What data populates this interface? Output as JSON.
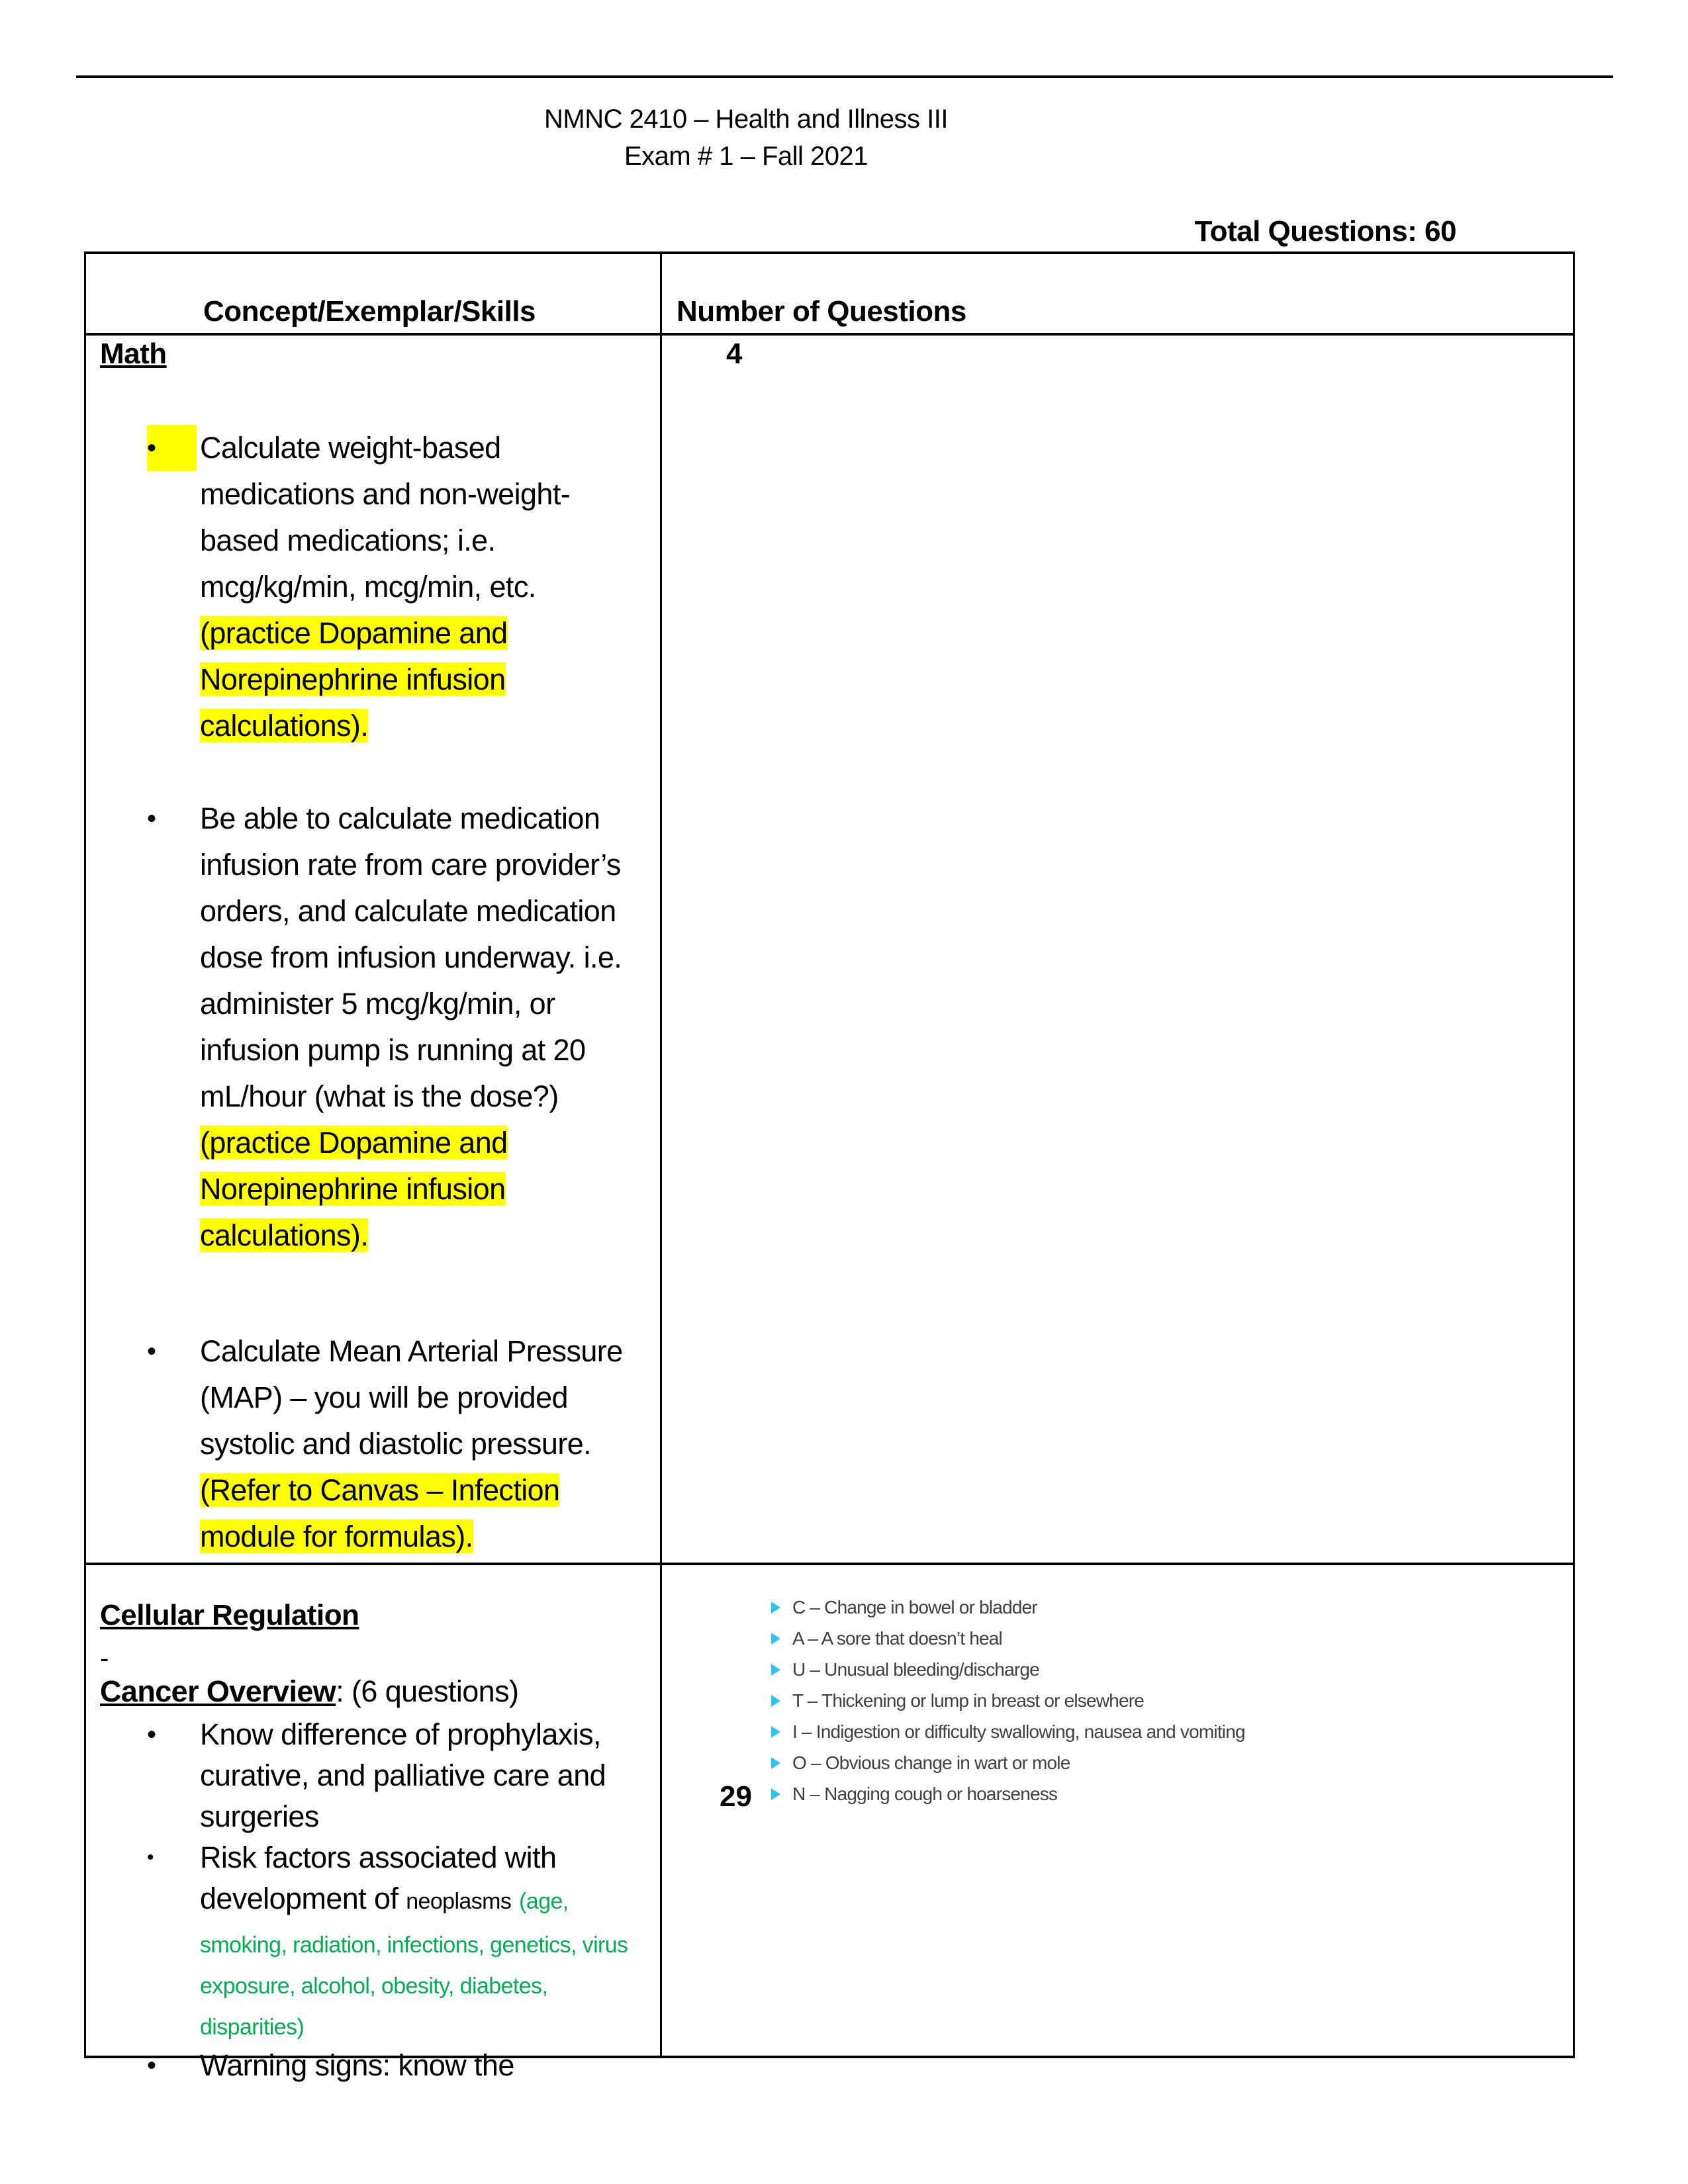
{
  "document": {
    "title_line1": "NMNC 2410 – Health and Illness III",
    "title_line2": "Exam # 1 – Fall 2021",
    "total_questions": "Total Questions: 60"
  },
  "table": {
    "headers": [
      "Concept/Exemplar/Skills",
      "Number of Questions"
    ],
    "rows": [
      {
        "section": "Math",
        "count": "4",
        "bullets": [
          {
            "text": "Calculate weight-based medications and non-weight-based medications; i.e. mcg/kg/min, mcg/min, etc.",
            "highlight": "(practice Dopamine and Norepinephrine infusion calculations)."
          },
          {
            "text": "Be able to calculate medication infusion rate from care provider’s orders, and calculate medication dose from infusion underway.  i.e. administer 5 mcg/kg/min, or infusion pump is running at 20 mL/hour (what is the dose?)",
            "highlight": "(practice Dopamine and Norepinephrine infusion calculations)."
          },
          {
            "text": "Calculate Mean Arterial Pressure (MAP) – you will be provided systolic and diastolic pressure.",
            "highlight": "(Refer to Canvas – Infection module for formulas)."
          }
        ]
      },
      {
        "section": "Cellular Regulation",
        "dash": "-",
        "subsection": "Cancer Overview",
        "subsection_suffix": ":  (6 questions)",
        "count": "29",
        "bullets": [
          {
            "text": "Know difference of prophylaxis, curative, and palliative care and surgeries"
          },
          {
            "text": "Risk factors associated with development of",
            "small": "neoplasms",
            "green": "(age, smoking, radiation, infections, genetics, virus exposure, alcohol, obesity, diabetes, disparities)"
          },
          {
            "text": "Warning signs:  know the"
          }
        ],
        "caution_list": [
          "C – Change in bowel or bladder",
          "A – A sore that doesn’t heal",
          "U – Unusual bleeding/discharge",
          "T – Thickening or lump in breast or elsewhere",
          "I – Indigestion or difficulty swallowing, nausea and vomiting",
          "O – Obvious change in wart or mole",
          "N – Nagging cough or hoarseness"
        ]
      }
    ]
  },
  "colors": {
    "highlight": "#ffff00",
    "risk_factor_text": "#00b050",
    "caution_bullet": "#29c5f6",
    "caution_text": "#404040"
  }
}
